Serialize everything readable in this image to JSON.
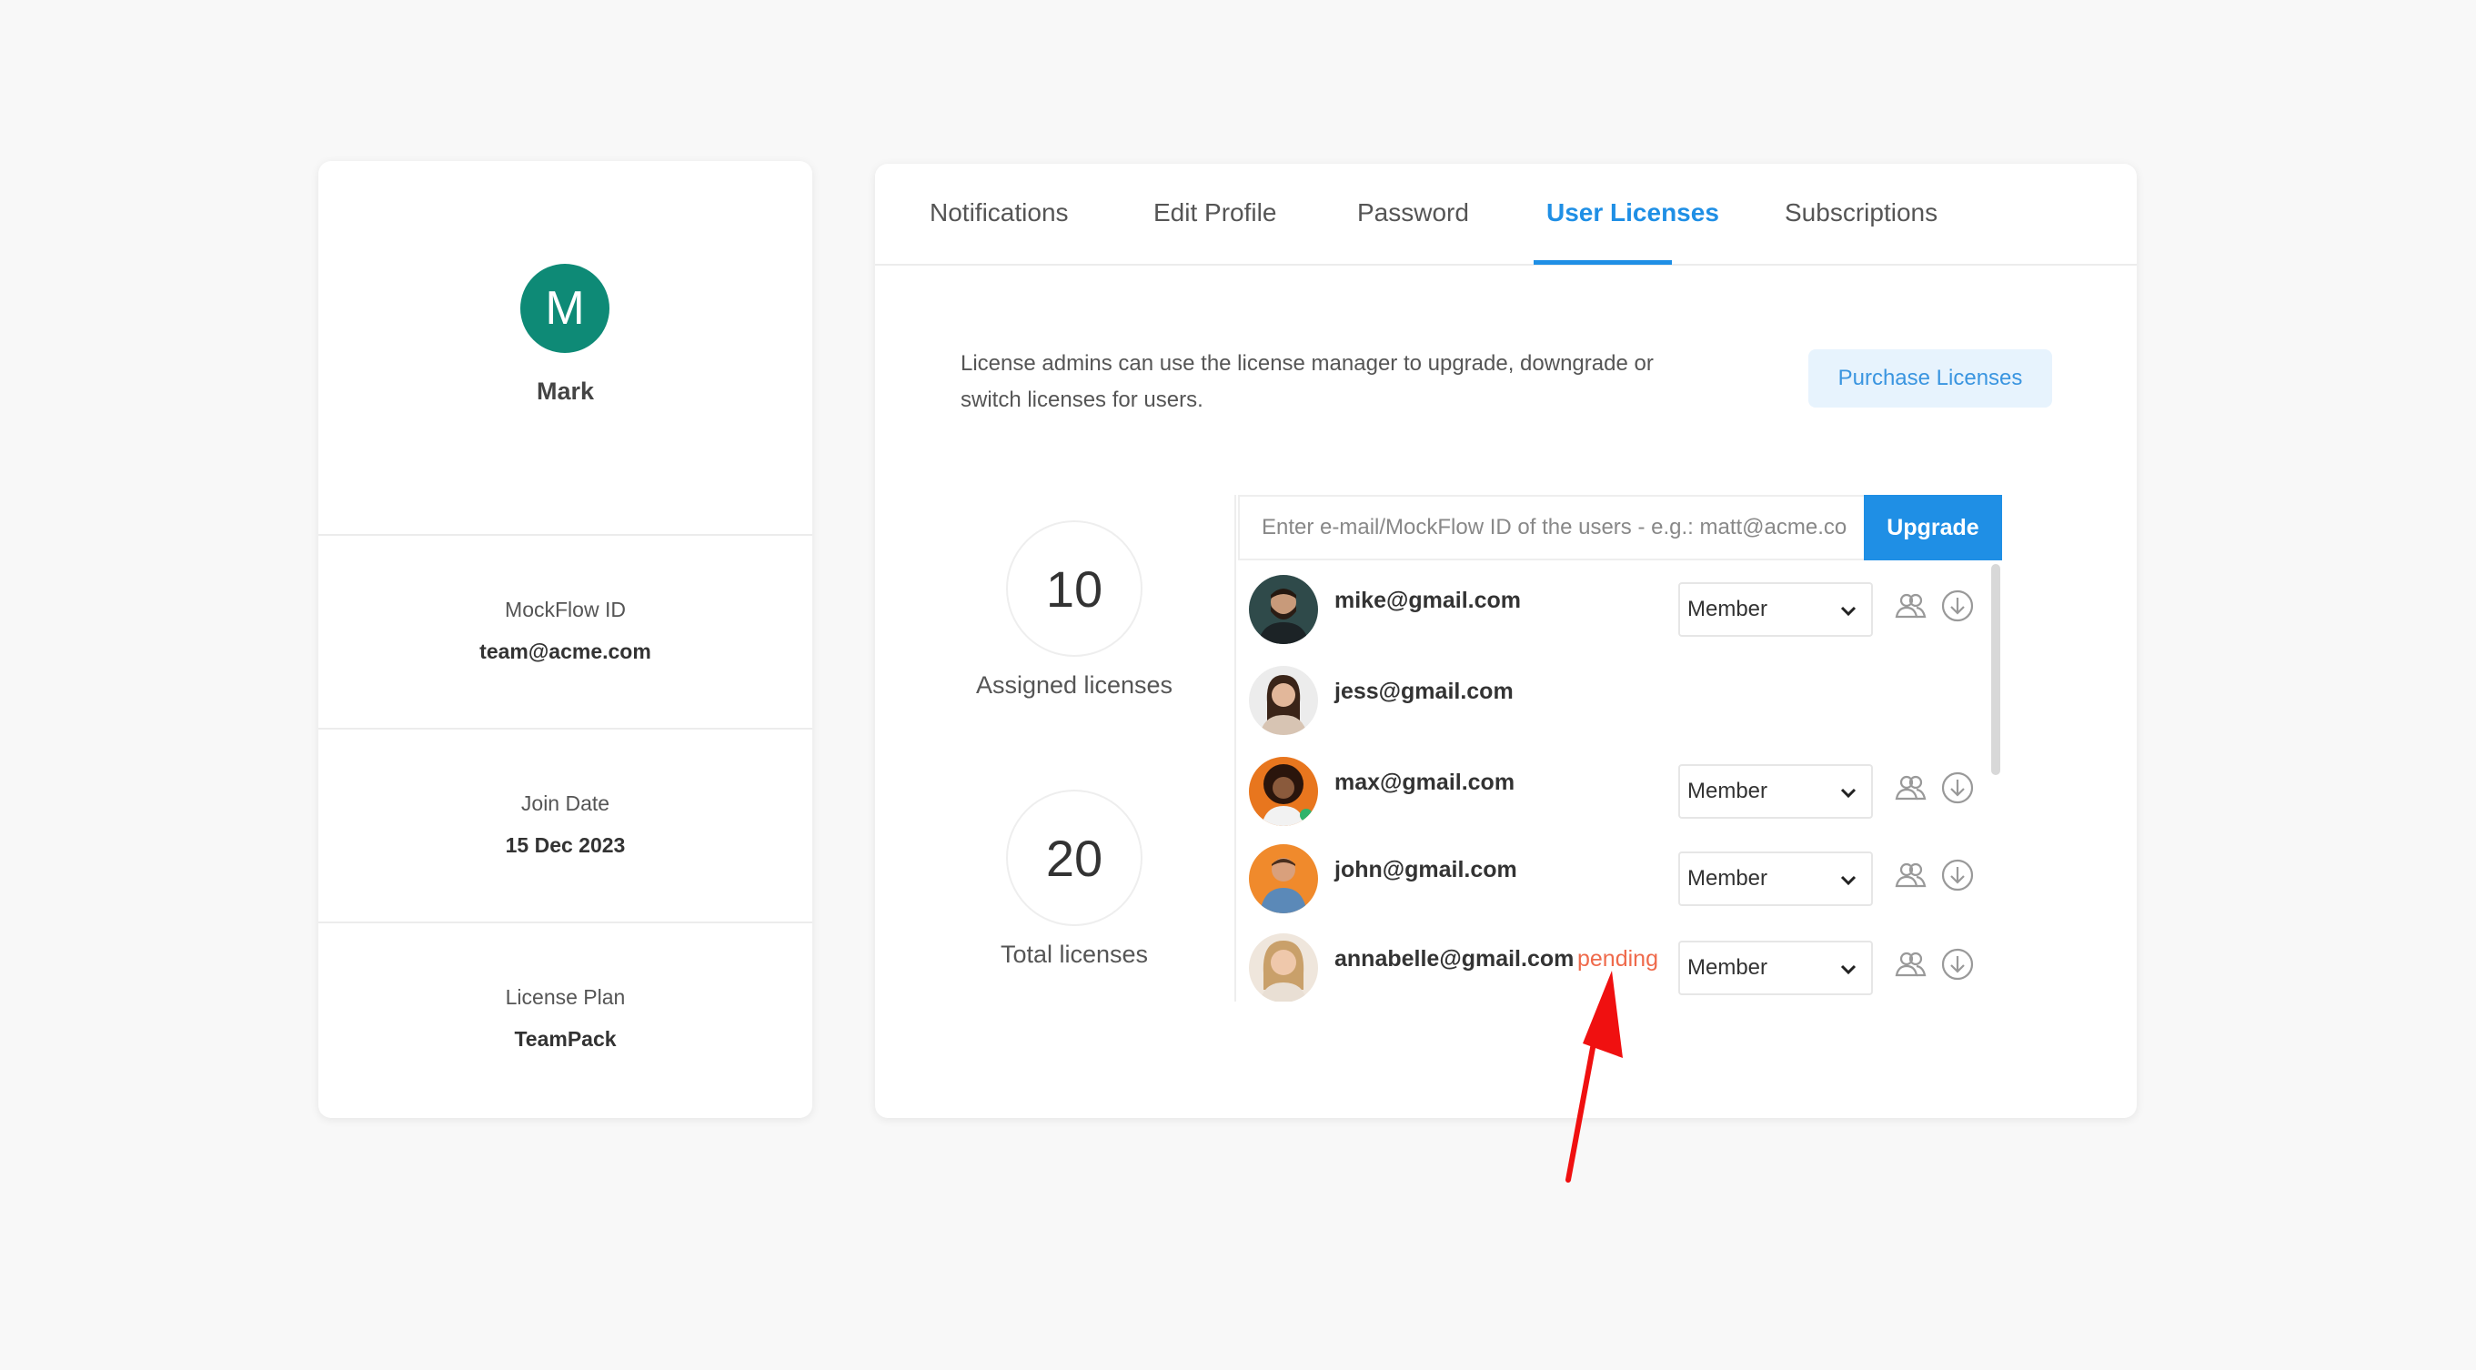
{
  "profile": {
    "avatar_letter": "M",
    "name": "Mark",
    "avatar_color": "#0e8a76",
    "info": [
      {
        "label": "MockFlow ID",
        "value": "team@acme.com"
      },
      {
        "label": "Join Date",
        "value": "15 Dec 2023"
      },
      {
        "label": "License Plan",
        "value": "TeamPack"
      }
    ]
  },
  "tabs": [
    {
      "label": "Notifications",
      "active": false
    },
    {
      "label": "Edit Profile",
      "active": false
    },
    {
      "label": "Password",
      "active": false
    },
    {
      "label": "User Licenses",
      "active": true
    },
    {
      "label": "Subscriptions",
      "active": false
    }
  ],
  "licenses": {
    "description": "License admins can use the license manager to upgrade, downgrade or switch licenses for users.",
    "purchase_label": "Purchase Licenses",
    "assigned": {
      "count": "10",
      "label": "Assigned licenses"
    },
    "total": {
      "count": "20",
      "label": "Total licenses"
    },
    "search_placeholder": "Enter e-mail/MockFlow ID of the users - e.g.: matt@acme.co",
    "upgrade_label": "Upgrade",
    "users": [
      {
        "email": "mike@gmail.com",
        "status": "",
        "role": "Member",
        "has_controls": true,
        "avatar_icon": "man-beard-avatar"
      },
      {
        "email": "jess@gmail.com",
        "status": "",
        "role": "",
        "has_controls": false,
        "avatar_icon": "woman-avatar"
      },
      {
        "email": "max@gmail.com",
        "status": "",
        "role": "Member",
        "has_controls": true,
        "avatar_icon": "woman-curly-avatar"
      },
      {
        "email": "john@gmail.com",
        "status": "",
        "role": "Member",
        "has_controls": true,
        "avatar_icon": "man-orange-avatar"
      },
      {
        "email": "annabelle@gmail.com",
        "status": "pending",
        "role": "Member",
        "has_controls": true,
        "avatar_icon": "woman-blonde-avatar"
      }
    ]
  },
  "colors": {
    "accent": "#1f8fe5",
    "pending": "#ef6a4b",
    "arrow": "#f01010"
  }
}
